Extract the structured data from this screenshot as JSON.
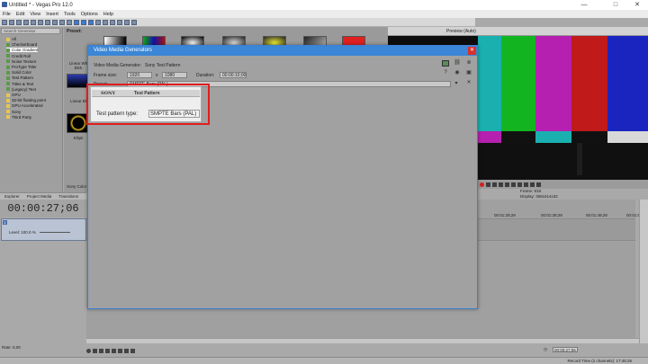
{
  "window": {
    "title": "Untitled * - Vegas Pro 12.0",
    "min": "—",
    "max": "□",
    "close": "✕"
  },
  "menu": [
    "File",
    "Edit",
    "View",
    "Insert",
    "Tools",
    "Options",
    "Help"
  ],
  "explorer": {
    "header": "Search Generator",
    "items": [
      {
        "label": "All",
        "color": "#e8c84a",
        "selected": false
      },
      {
        "label": "Checkerboard",
        "color": "#5a9a4a",
        "selected": false
      },
      {
        "label": "Color Gradient",
        "color": "#5a9a4a",
        "selected": true
      },
      {
        "label": "Credit Roll",
        "color": "#5a9a4a",
        "selected": false
      },
      {
        "label": "Noise Texture",
        "color": "#5a9a4a",
        "selected": false
      },
      {
        "label": "ProType Titler",
        "color": "#5a9a4a",
        "selected": false
      },
      {
        "label": "Solid Color",
        "color": "#5a9a4a",
        "selected": false
      },
      {
        "label": "Test Pattern",
        "color": "#5a9a4a",
        "selected": false
      },
      {
        "label": "Titles & Text",
        "color": "#5a9a4a",
        "selected": false
      },
      {
        "label": "(Legacy) Text",
        "color": "#5a9a4a",
        "selected": false
      },
      {
        "label": "GPU",
        "color": "#e8c84a",
        "selected": false
      },
      {
        "label": "32-bit floating point",
        "color": "#e8c84a",
        "selected": false
      },
      {
        "label": "GPU Accelerated",
        "color": "#e8c84a",
        "selected": false
      },
      {
        "label": "Sony",
        "color": "#e8c84a",
        "selected": false
      },
      {
        "label": "Third Party",
        "color": "#e8c84a",
        "selected": false
      }
    ]
  },
  "presets": {
    "label": "Preset:",
    "thumb_labels": [
      "Linear Wh Blck",
      "Linear Bl",
      "Ellipti"
    ],
    "bottom_label": "Sony Color Gr"
  },
  "preview": {
    "label": "Preview (Auto)",
    "frame_label": "Frame:",
    "frame_value": "818",
    "display_label": "Display:",
    "display_value": "358x414x32"
  },
  "tabs": [
    "Explorer",
    "Project Media",
    "Transitions"
  ],
  "timeline": {
    "time": "00:00:27;06",
    "track_number": "1",
    "level": "Level: 100.0 %",
    "ruler": [
      "00:01:29;29",
      "00:01:39;29",
      "00:01:49;29",
      "00:01:59;28"
    ],
    "rate": "Rate: 0,00",
    "end_time": "00:00:27;06",
    "status": "Record Time (2 channels): 17:45:26"
  },
  "dialog": {
    "title": "Video Media Generators",
    "generator_label": "Video Media Generator:",
    "generator_value": "Sony Test Pattern",
    "frame_size_label": "Frame size:",
    "width": "1920",
    "x": "x",
    "height": "1080",
    "duration_label": "Duration:",
    "duration": "00:00:10;00",
    "preset_label": "Preset:",
    "preset_value": "SMPTE Bars (PAL)",
    "prop_vendor": "SONY",
    "prop_title": "Test Pattern",
    "pattern_label": "Test pattern type:",
    "pattern_value": "SMPTE Bars (PAL)",
    "help": "?"
  }
}
